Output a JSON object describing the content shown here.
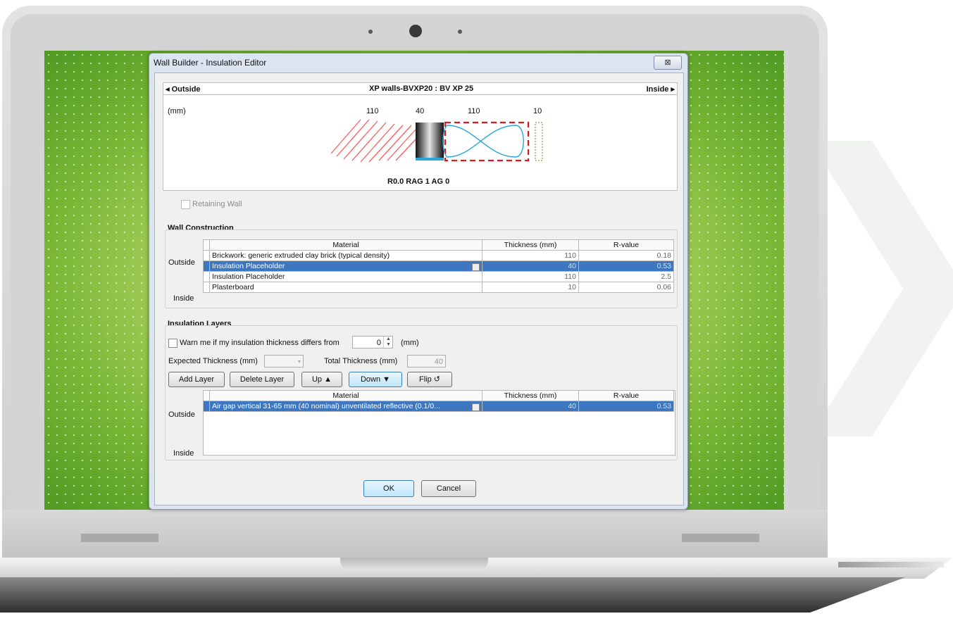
{
  "dialog": {
    "title": "Wall Builder - Insulation Editor",
    "close_label": "⊠"
  },
  "preview": {
    "outside_label": "◂ Outside",
    "inside_label": "Inside ▸",
    "wall_name": "XP walls-BVXP20 : BV XP 25",
    "unit_label": "(mm)",
    "thicknesses": [
      "110",
      "40",
      "110",
      "10"
    ],
    "rating": "R0.0 RAG 1 AG 0"
  },
  "retaining_wall": {
    "label": "Retaining Wall",
    "checked": false
  },
  "wall_construction": {
    "title": "Wall Construction",
    "outside_label": "Outside",
    "inside_label": "Inside",
    "columns": [
      "Material",
      "Thickness (mm)",
      "R-value"
    ],
    "rows": [
      {
        "material": "Brickwork: generic extruded clay brick (typical density)",
        "thickness": "110",
        "r_value": "0.18",
        "selected": false
      },
      {
        "material": "Insulation Placeholder",
        "thickness": "40",
        "r_value": "0.53",
        "selected": true
      },
      {
        "material": "Insulation Placeholder",
        "thickness": "110",
        "r_value": "2.5",
        "selected": false
      },
      {
        "material": "Plasterboard",
        "thickness": "10",
        "r_value": "0.06",
        "selected": false
      }
    ]
  },
  "insulation_layers": {
    "title": "Insulation Layers",
    "warn_label": "Warn me if my insulation thickness differs from",
    "warn_value": "0",
    "warn_unit": "(mm)",
    "expected_label": "Expected Thickness (mm)",
    "expected_value": "",
    "total_label": "Total Thickness (mm)",
    "total_value": "40",
    "buttons": {
      "add": "Add Layer",
      "delete": "Delete Layer",
      "up": "Up ▲",
      "down": "Down ▼",
      "flip": "Flip ↺"
    },
    "outside_label": "Outside",
    "inside_label": "Inside",
    "columns": [
      "Material",
      "Thickness (mm)",
      "R-value"
    ],
    "rows": [
      {
        "material": "Air gap vertical 31-65 mm (40 nominal) unventilated reflective (0.1/0...",
        "thickness": "40",
        "r_value": "0.53",
        "selected": true
      }
    ]
  },
  "footer": {
    "ok": "OK",
    "cancel": "Cancel"
  },
  "colors": {
    "selection": "#3d77bf",
    "hatch": "#ff4d4d",
    "insulation": "#2aa7d9",
    "placeholder_border": "#e0181e"
  }
}
